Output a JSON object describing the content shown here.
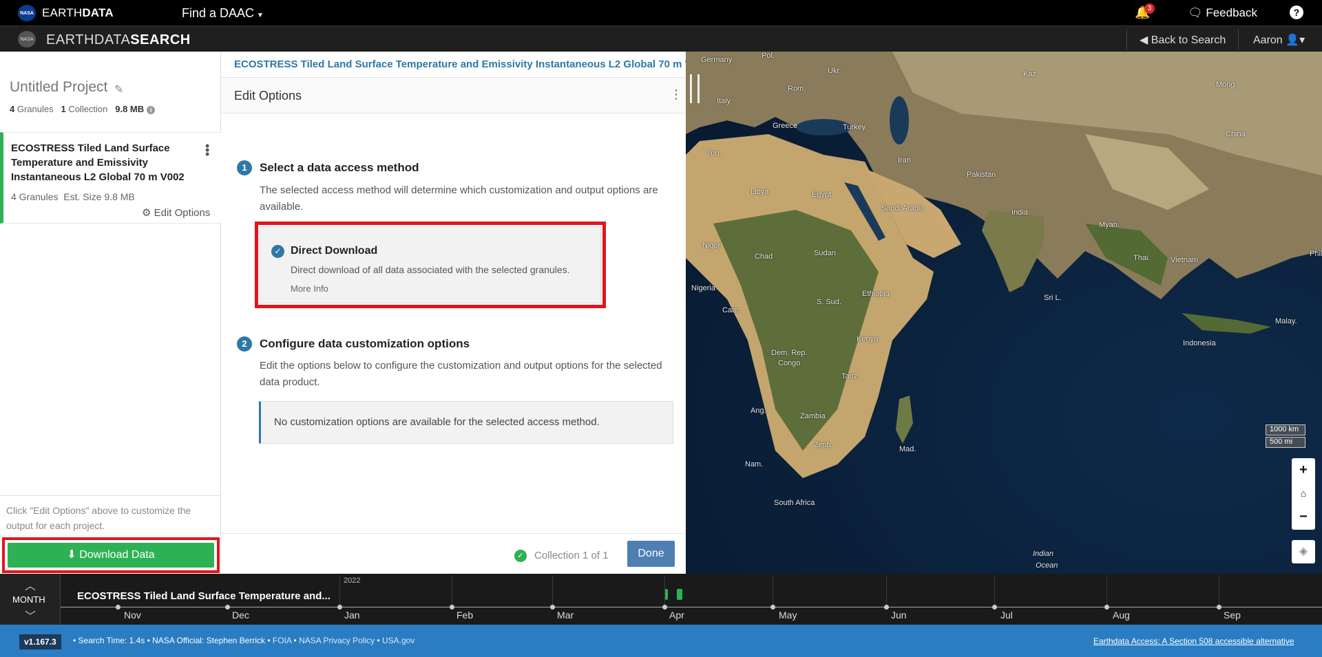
{
  "topbar": {
    "brand_light": "EARTH",
    "brand_bold": "DATA",
    "find_daac": "Find a DAAC",
    "notification_count": "3",
    "feedback": "Feedback",
    "help": "?"
  },
  "subbar": {
    "brand_light": "EARTHDATA",
    "brand_bold": "SEARCH",
    "back_to_search": "Back to Search",
    "user": "Aaron"
  },
  "sidebar": {
    "project_title": "Untitled Project",
    "granule_count": "4",
    "granule_label": "Granules",
    "collection_count": "1",
    "collection_label": "Collection",
    "size": "9.8 MB",
    "collection": {
      "title": "ECOSTRESS Tiled Land Surface Temperature and Emissivity Instantaneous L2 Global 70 m V002",
      "granules": "4 Granules",
      "est_size": "Est. Size 9.8 MB",
      "edit_options": "Edit Options"
    },
    "hint": "Click \"Edit Options\" above to customize the output for each project.",
    "download_button": "Download Data"
  },
  "panel": {
    "collection_link": "ECOSTRESS Tiled Land Surface Temperature and Emissivity Instantaneous L2 Global 70 m V",
    "title": "Edit Options",
    "step1": {
      "number": "1",
      "title": "Select a data access method",
      "description": "The selected access method will determine which customization and output options are available."
    },
    "method": {
      "title": "Direct Download",
      "description": "Direct download of all data associated with the selected granules.",
      "more_info": "More Info"
    },
    "step2": {
      "number": "2",
      "title": "Configure data customization options",
      "description": "Edit the options below to configure the customization and output options for the selected data product."
    },
    "no_options": "No customization options are available for the selected access method.",
    "footer_status": "Collection 1 of 1",
    "done_button": "Done"
  },
  "map": {
    "labels": [
      {
        "text": "Germany"
      },
      {
        "text": "Pol."
      },
      {
        "text": "Ukr."
      },
      {
        "text": "Kaz."
      },
      {
        "text": "Mong."
      },
      {
        "text": "Italy"
      },
      {
        "text": "Rom."
      },
      {
        "text": "Greece"
      },
      {
        "text": "Turkey"
      },
      {
        "text": "China"
      },
      {
        "text": "Tun."
      },
      {
        "text": "Iran"
      },
      {
        "text": "Pakistan"
      },
      {
        "text": "Libya"
      },
      {
        "text": "Egypt"
      },
      {
        "text": "Saudi Arabia"
      },
      {
        "text": "India"
      },
      {
        "text": "Myan."
      },
      {
        "text": "Niger"
      },
      {
        "text": "Chad"
      },
      {
        "text": "Sudan"
      },
      {
        "text": "Thai."
      },
      {
        "text": "Vietnam"
      },
      {
        "text": "Phil."
      },
      {
        "text": "Nigeria"
      },
      {
        "text": "Ethiopia"
      },
      {
        "text": "S. Sud."
      },
      {
        "text": "Cam."
      },
      {
        "text": "Sri L."
      },
      {
        "text": "Malay."
      },
      {
        "text": "Kenya"
      },
      {
        "text": "Dem. Rep."
      },
      {
        "text": "Congo"
      },
      {
        "text": "Indonesia"
      },
      {
        "text": "Tanz."
      },
      {
        "text": "Ang."
      },
      {
        "text": "Zambia"
      },
      {
        "text": "Zimb."
      },
      {
        "text": "Mad."
      },
      {
        "text": "Nam."
      },
      {
        "text": "South Africa"
      },
      {
        "text": "Indian"
      },
      {
        "text": "Ocean"
      }
    ],
    "scale_km": "1000 km",
    "scale_mi": "500 mi"
  },
  "timeline": {
    "interval": "MONTH",
    "collection_title": "ECOSTRESS Tiled Land Surface Temperature and...",
    "year": "2022",
    "months": [
      "Nov",
      "Dec",
      "Jan",
      "Feb",
      "Mar",
      "Apr",
      "May",
      "Jun",
      "Jul",
      "Aug",
      "Sep"
    ]
  },
  "footer": {
    "version": "v1.167.3",
    "search_time": "• Search Time: 1.4s",
    "official": "• NASA Official: Stephen Berrick",
    "foia": "FOIA",
    "privacy": "NASA Privacy Policy",
    "usagov": "USA.gov",
    "accessible_link": "Earthdata Access: A Section 508 accessible alternative"
  }
}
